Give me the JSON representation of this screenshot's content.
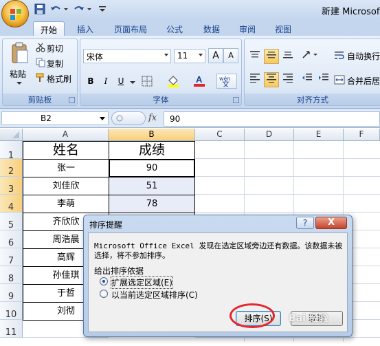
{
  "window": {
    "title": "新建 Microsoft"
  },
  "tabs": [
    "开始",
    "插入",
    "页面布局",
    "公式",
    "数据",
    "审阅",
    "视图"
  ],
  "clipboard": {
    "paste": "粘贴",
    "cut": "剪切",
    "copy": "复制",
    "format_painter": "格式刷",
    "label": "剪贴板"
  },
  "font": {
    "name": "宋体",
    "size": "11",
    "label": "字体",
    "bold": "B",
    "italic": "I",
    "underline": "U",
    "grow": "A",
    "shrink": "A"
  },
  "alignment": {
    "wrap": "自动换行",
    "merge": "合并后居",
    "label": "对齐方式"
  },
  "formula_bar": {
    "name_box": "B2",
    "fx": "fx",
    "value": "90"
  },
  "columns": [
    "A",
    "B",
    "C",
    "D",
    "E",
    "F"
  ],
  "rows": [
    "1",
    "2",
    "3",
    "4",
    "5",
    "6",
    "7",
    "8",
    "9",
    "10",
    "11"
  ],
  "sheet": {
    "headers": [
      "姓名",
      "成绩"
    ],
    "names": [
      "张一",
      "刘佳欣",
      "李萌",
      "齐欣欣",
      "周浩晨",
      "高辉",
      "孙佳琪",
      "于哲",
      "刘彻"
    ],
    "scores": [
      "90",
      "51",
      "78"
    ]
  },
  "dialog": {
    "title": "排序提醒",
    "help": "?",
    "close": "X",
    "message_line1": "Microsoft Office Excel 发现在选定区域旁边还有数据。该数据未被",
    "message_line2": "选择，将不参加排序。",
    "group_label": "给出排序依据",
    "option_expand": "扩展选定区域(E)",
    "option_current": "以当前选定区域排序(C)",
    "selected_option": "option_expand",
    "sort_button": "排序(S)",
    "cancel_button": "取消"
  },
  "watermark": "Bai 经验",
  "colors": {
    "ribbon": "#dbe7f7",
    "selection": "#f8cf7b",
    "annotation": "#e3262f"
  }
}
